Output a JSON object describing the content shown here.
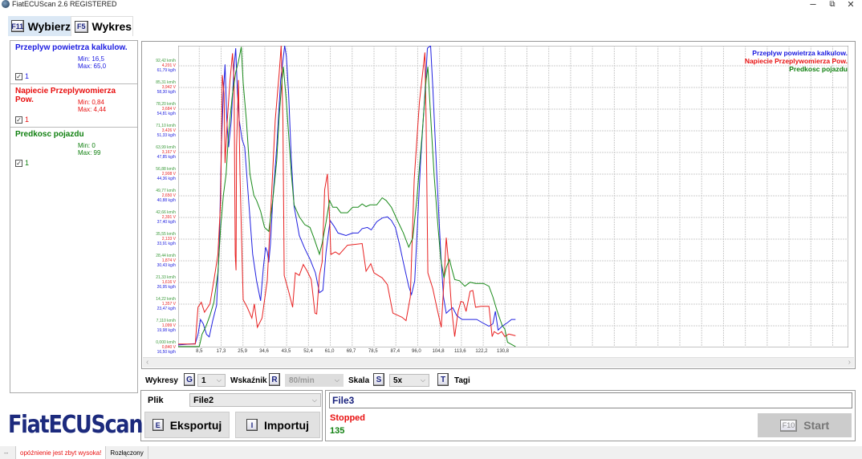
{
  "window": {
    "title": "FiatECUScan 2.6 REGISTERED",
    "minimize": "–",
    "restore": "⧉",
    "close": "✕"
  },
  "tabs": [
    {
      "key": "F11",
      "label": "Wybierz",
      "active": false
    },
    {
      "key": "F5",
      "label": "Wykres",
      "active": true
    }
  ],
  "parameters": [
    {
      "name": "Przeplyw powietrza kalkulow.",
      "min": "Min: 16,5",
      "max": "Max: 65,0",
      "check": "✓",
      "index": "1",
      "color": "#1a1ae0"
    },
    {
      "name": "Napiecie Przeplywomierza Pow.",
      "min": "Min: 0,84",
      "max": "Max: 4,44",
      "check": "✓",
      "index": "1",
      "color": "#e81010"
    },
    {
      "name": "Predkosc pojazdu",
      "min": "Min: 0",
      "max": "Max: 99",
      "check": "✓",
      "index": "1",
      "color": "#108010"
    }
  ],
  "chart_data": {
    "type": "line",
    "xlim": [
      0,
      270
    ],
    "x_ticks": [
      "8,5",
      "17,3",
      "25,9",
      "34,6",
      "43,5",
      "52,4",
      "61,0",
      "69,7",
      "78,5",
      "87,4",
      "96,0",
      "104,8",
      "113,6",
      "122,2",
      "130,8"
    ],
    "x_tick_values": [
      8.5,
      17.3,
      25.9,
      34.6,
      43.5,
      52.4,
      61.0,
      69.7,
      78.5,
      87.4,
      96.0,
      104.8,
      113.6,
      122.2,
      130.8
    ],
    "grid": true,
    "legend": "top-right",
    "y_tick_groups": [
      [
        "0,000 km/h",
        "0,840 V",
        "16,50 kg/h"
      ],
      [
        "7,110 km/h",
        "1,099 V",
        "19,98 kg/h"
      ],
      [
        "14,22 km/h",
        "1,357 V",
        "23,47 kg/h"
      ],
      [
        "21,33 km/h",
        "1,616 V",
        "26,95 kg/h"
      ],
      [
        "28,44 km/h",
        "1,874 V",
        "30,43 kg/h"
      ],
      [
        "35,55 km/h",
        "2,133 V",
        "33,91 kg/h"
      ],
      [
        "42,66 km/h",
        "2,391 V",
        "37,40 kg/h"
      ],
      [
        "49,77 km/h",
        "2,650 V",
        "40,88 kg/h"
      ],
      [
        "56,88 km/h",
        "2,908 V",
        "44,36 kg/h"
      ],
      [
        "63,99 km/h",
        "3,167 V",
        "47,85 kg/h"
      ],
      [
        "71,10 km/h",
        "3,426 V",
        "51,33 kg/h"
      ],
      [
        "78,20 km/h",
        "3,684 V",
        "54,81 kg/h"
      ],
      [
        "85,31 km/h",
        "3,942 V",
        "58,30 kg/h"
      ],
      [
        "92,42 km/h",
        "4,201 V",
        "61,79 kg/h"
      ]
    ],
    "series": [
      {
        "name": "Przeplyw powietrza kalkulow.",
        "unit": "kg/h",
        "color": "#2020e0",
        "ylim": [
          16.5,
          65.0
        ],
        "points": [
          [
            0,
            16.9
          ],
          [
            6.9,
            17.1
          ],
          [
            8,
            18.6
          ],
          [
            9,
            21
          ],
          [
            10.1,
            20.3
          ],
          [
            11.4,
            18.6
          ],
          [
            12.5,
            18.2
          ],
          [
            13.9,
            20.8
          ],
          [
            15.5,
            23.3
          ],
          [
            16.6,
            33.2
          ],
          [
            17.4,
            48.7
          ],
          [
            18.2,
            57.3
          ],
          [
            18.9,
            62
          ],
          [
            19.6,
            53
          ],
          [
            20.3,
            48.7
          ],
          [
            21.4,
            53
          ],
          [
            22.5,
            61.6
          ],
          [
            23.2,
            64.6
          ],
          [
            23.9,
            57.3
          ],
          [
            24.6,
            53
          ],
          [
            25.7,
            50
          ],
          [
            26.8,
            48.7
          ],
          [
            28.4,
            40.1
          ],
          [
            30,
            31.5
          ],
          [
            31.6,
            27.2
          ],
          [
            33.2,
            24
          ],
          [
            34.3,
            29.3
          ],
          [
            35.2,
            32.6
          ],
          [
            35.9,
            31.9
          ],
          [
            36.5,
            30.2
          ],
          [
            37.2,
            33.2
          ],
          [
            38.1,
            40.1
          ],
          [
            39.7,
            48.7
          ],
          [
            41.3,
            59.5
          ],
          [
            42.9,
            65
          ],
          [
            43.6,
            63.3
          ],
          [
            44.5,
            57.3
          ],
          [
            45.6,
            46.6
          ],
          [
            46.7,
            39.2
          ],
          [
            48.8,
            34.5
          ],
          [
            51,
            32.4
          ],
          [
            53.1,
            30.7
          ],
          [
            55.3,
            28.5
          ],
          [
            56.9,
            25.3
          ],
          [
            58.3,
            25.7
          ],
          [
            59.6,
            31.9
          ],
          [
            61.2,
            36.9
          ],
          [
            62.8,
            36
          ],
          [
            64.4,
            34.9
          ],
          [
            67.6,
            34.5
          ],
          [
            70.3,
            34.9
          ],
          [
            72.5,
            34.9
          ],
          [
            74.1,
            35.6
          ],
          [
            76.2,
            35.8
          ],
          [
            77.8,
            35.4
          ],
          [
            80,
            36.7
          ],
          [
            82.2,
            37.3
          ],
          [
            84.3,
            37.5
          ],
          [
            85.9,
            36.9
          ],
          [
            87.5,
            35.8
          ],
          [
            89.1,
            33.2
          ],
          [
            90.7,
            30.2
          ],
          [
            92.9,
            26.3
          ],
          [
            94,
            25
          ],
          [
            95.3,
            27.2
          ],
          [
            96.1,
            33.7
          ],
          [
            97.7,
            46.6
          ],
          [
            99.4,
            57.3
          ],
          [
            100.4,
            64.6
          ],
          [
            101.7,
            65
          ],
          [
            102.6,
            58.2
          ],
          [
            104.2,
            44.4
          ],
          [
            105.8,
            31.5
          ],
          [
            106.9,
            24.6
          ],
          [
            108,
            22
          ],
          [
            109.3,
            22.5
          ],
          [
            110.6,
            22.9
          ],
          [
            112.3,
            21.6
          ],
          [
            114.4,
            21
          ],
          [
            120.3,
            21
          ],
          [
            122.5,
            20.5
          ],
          [
            125.2,
            19.9
          ],
          [
            126.8,
            20.3
          ],
          [
            127.8,
            22.3
          ],
          [
            128.9,
            19.3
          ],
          [
            130.5,
            19.9
          ],
          [
            132.7,
            20.5
          ],
          [
            134.3,
            21
          ],
          [
            135.9,
            21
          ]
        ]
      },
      {
        "name": "Napiecie Przeplywomierza Pow.",
        "unit": "V",
        "color": "#e82020",
        "ylim": [
          0.84,
          4.44
        ],
        "points": [
          [
            0,
            0.88
          ],
          [
            6.9,
            0.88
          ],
          [
            8,
            1.32
          ],
          [
            9.3,
            1.38
          ],
          [
            10.6,
            1.26
          ],
          [
            12.8,
            1.36
          ],
          [
            14.4,
            1.64
          ],
          [
            16,
            1.95
          ],
          [
            17.1,
            2.59
          ],
          [
            17.8,
            4.09
          ],
          [
            18.5,
            3.87
          ],
          [
            18.9,
            3.04
          ],
          [
            19.8,
            3.55
          ],
          [
            20.9,
            4.03
          ],
          [
            21.9,
            4.35
          ],
          [
            22.5,
            4.03
          ],
          [
            23,
            1.95
          ],
          [
            23.3,
            1.76
          ],
          [
            23.5,
            3.23
          ],
          [
            24.3,
            4.03
          ],
          [
            24.9,
            2.91
          ],
          [
            25.7,
            1.95
          ],
          [
            26.2,
            1.41
          ],
          [
            27.8,
            1.32
          ],
          [
            29.7,
            1.19
          ],
          [
            30.7,
            1.36
          ],
          [
            31.9,
            1.08
          ],
          [
            33.8,
            1.19
          ],
          [
            35.9,
            1.64
          ],
          [
            37.5,
            2.59
          ],
          [
            39.1,
            3.55
          ],
          [
            40.7,
            4.12
          ],
          [
            41.5,
            4.44
          ],
          [
            42.2,
            3.55
          ],
          [
            42.7,
            1.7
          ],
          [
            44.5,
            1.51
          ],
          [
            46.1,
            1.32
          ],
          [
            47.2,
            1.73
          ],
          [
            48.8,
            1.7
          ],
          [
            50.4,
            1.83
          ],
          [
            52,
            1.75
          ],
          [
            53.6,
            1.65
          ],
          [
            55.1,
            1.25
          ],
          [
            55.8,
            1.24
          ],
          [
            56.9,
            1.7
          ],
          [
            58,
            1.86
          ],
          [
            59,
            2.72
          ],
          [
            60.1,
            2.91
          ],
          [
            61,
            2.4
          ],
          [
            61.5,
            1.95
          ],
          [
            63.3,
            1.98
          ],
          [
            64.9,
            1.95
          ],
          [
            68.2,
            2.06
          ],
          [
            74.1,
            2.08
          ],
          [
            75.7,
            1.75
          ],
          [
            77.6,
            1.84
          ],
          [
            78.9,
            1.73
          ],
          [
            82.2,
            1.67
          ],
          [
            84.3,
            1.59
          ],
          [
            86.5,
            1.25
          ],
          [
            90.2,
            1.2
          ],
          [
            91.8,
            1.16
          ],
          [
            93.5,
            1.44
          ],
          [
            95.1,
            2.85
          ],
          [
            97.2,
            3.77
          ],
          [
            99.4,
            4.36
          ],
          [
            99.9,
            3.55
          ],
          [
            100.6,
            1.73
          ],
          [
            102.6,
            1.54
          ],
          [
            104.2,
            1.32
          ],
          [
            106,
            1.08
          ],
          [
            107.1,
            1.64
          ],
          [
            108,
            2.15
          ],
          [
            108.8,
            1.89
          ],
          [
            110.1,
            1.32
          ],
          [
            111.4,
            0.97
          ],
          [
            112.8,
            1.27
          ],
          [
            113.9,
            1.39
          ],
          [
            114.9,
            1.38
          ],
          [
            116,
            1.27
          ],
          [
            117.6,
            1.51
          ],
          [
            118.7,
            1.52
          ],
          [
            119.8,
            1.32
          ],
          [
            121.9,
            1.33
          ],
          [
            125.2,
            1.33
          ],
          [
            126.5,
            0.97
          ],
          [
            127.3,
            1.03
          ],
          [
            128.9,
            1.0
          ],
          [
            130.3,
            1.03
          ],
          [
            131.6,
            0.97
          ],
          [
            133.2,
            1.0
          ],
          [
            135.9,
            0.98
          ]
        ]
      },
      {
        "name": "Predkosc pojazdu",
        "unit": "km/h",
        "color": "#1a8a1a",
        "ylim": [
          0,
          99
        ],
        "points": [
          [
            0,
            0.3
          ],
          [
            8.5,
            0.3
          ],
          [
            9.6,
            4.3
          ],
          [
            11.2,
            6.9
          ],
          [
            12.8,
            10.5
          ],
          [
            14.4,
            14.8
          ],
          [
            16,
            24.5
          ],
          [
            17.1,
            39.4
          ],
          [
            18.2,
            49.9
          ],
          [
            19.3,
            56.9
          ],
          [
            20.3,
            70.1
          ],
          [
            21.9,
            83.3
          ],
          [
            23.2,
            90.3
          ],
          [
            24.3,
            93.8
          ],
          [
            25.4,
            98.6
          ],
          [
            26.2,
            86.8
          ],
          [
            27.5,
            74.5
          ],
          [
            28.9,
            56.9
          ],
          [
            30.5,
            49.9
          ],
          [
            31.6,
            48.2
          ],
          [
            33.2,
            44.7
          ],
          [
            34.8,
            39.4
          ],
          [
            36.5,
            38.1
          ],
          [
            38.1,
            48.2
          ],
          [
            39.7,
            61.4
          ],
          [
            40.7,
            76.2
          ],
          [
            41.8,
            87.7
          ],
          [
            42.4,
            92.1
          ],
          [
            43.5,
            81.6
          ],
          [
            44.5,
            70.1
          ],
          [
            45.6,
            56.9
          ],
          [
            46.7,
            46.8
          ],
          [
            48.8,
            42.9
          ],
          [
            51,
            40.3
          ],
          [
            53.1,
            39.4
          ],
          [
            54.7,
            35.9
          ],
          [
            56.9,
            30.6
          ],
          [
            58,
            34.2
          ],
          [
            59.6,
            41.2
          ],
          [
            61,
            48.2
          ],
          [
            62.3,
            46
          ],
          [
            63.9,
            46
          ],
          [
            65.5,
            44.2
          ],
          [
            68.2,
            44.2
          ],
          [
            70.3,
            46
          ],
          [
            72.5,
            46
          ],
          [
            74.1,
            47.1
          ],
          [
            75.7,
            46.2
          ],
          [
            77.3,
            46.8
          ],
          [
            80,
            46.8
          ],
          [
            82.2,
            49.1
          ],
          [
            83.8,
            48.2
          ],
          [
            85.9,
            46
          ],
          [
            88.6,
            41.2
          ],
          [
            90.7,
            37.6
          ],
          [
            92.9,
            32.9
          ],
          [
            94.5,
            35.9
          ],
          [
            96.1,
            48.2
          ],
          [
            98.3,
            70.1
          ],
          [
            99.9,
            87.7
          ],
          [
            100.6,
            92.1
          ],
          [
            101.5,
            78.9
          ],
          [
            103.1,
            56.9
          ],
          [
            104.7,
            39.4
          ],
          [
            105.8,
            28.9
          ],
          [
            107.1,
            22.8
          ],
          [
            108,
            26.2
          ],
          [
            109.3,
            28.9
          ],
          [
            110.1,
            26.2
          ],
          [
            111.4,
            22.3
          ],
          [
            113.3,
            21.9
          ],
          [
            115.5,
            20.1
          ],
          [
            117.6,
            21.4
          ],
          [
            119.8,
            21
          ],
          [
            123,
            21
          ],
          [
            125.2,
            20.1
          ],
          [
            126.8,
            16.6
          ],
          [
            128.4,
            12.2
          ],
          [
            129.5,
            9.6
          ],
          [
            130.5,
            7.3
          ],
          [
            131.6,
            6
          ],
          [
            132.7,
            1.7
          ],
          [
            135.9,
            0.3
          ]
        ]
      }
    ]
  },
  "controls": {
    "charts_label": "Wykresy",
    "charts_key": "G",
    "charts_value": "1",
    "pointer_label": "Wskaźnik",
    "pointer_key": "R",
    "pointer_value": "80/min",
    "scale_label": "Skala",
    "scale_key": "S",
    "scale_value": "5x",
    "tags_key": "T",
    "tags_label": "Tagi"
  },
  "file": {
    "label": "Plik",
    "value": "File2",
    "export_key": "E",
    "export_label": "Eksportuj",
    "import_key": "I",
    "import_label": "Importuj"
  },
  "session": {
    "filename": "File3",
    "status": "Stopped",
    "count": "135",
    "start_key": "F10",
    "start_label": "Start"
  },
  "logo": "FiatECUScan",
  "statusbar": {
    "item0": "--",
    "warning": "opóźnienie jest zbyt wysoka!",
    "connection": "Rozłączony"
  },
  "icons": {
    "chevron": "⌵",
    "scroll_left": "‹",
    "scroll_right": "›"
  }
}
